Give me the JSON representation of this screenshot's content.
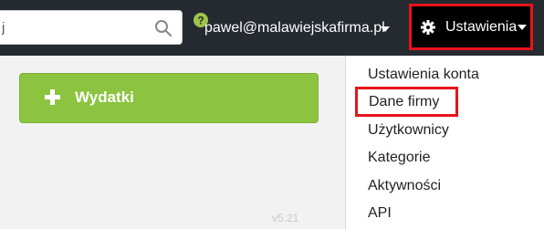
{
  "search": {
    "value": "j",
    "placeholder": ""
  },
  "header": {
    "user_email": "pawel@malawiejskafirma.pl",
    "settings_label": "Ustawienia"
  },
  "main": {
    "add_expense_label": "Wydatki",
    "version": "v5.21"
  },
  "settings_menu": {
    "items": [
      {
        "label": "Ustawienia konta"
      },
      {
        "label": "Dane firmy",
        "highlighted": true
      },
      {
        "label": "Użytkownicy"
      },
      {
        "label": "Kategorie"
      },
      {
        "label": "Aktywności"
      },
      {
        "label": "API"
      }
    ]
  },
  "colors": {
    "topbar": "#252a30",
    "accent_green": "#8cc43f",
    "highlight_red": "#e8141b",
    "help_icon": "#9ec44a"
  },
  "icons": [
    "search-icon",
    "help-icon",
    "gear-icon",
    "plus-icon",
    "chevron-down-icon"
  ]
}
